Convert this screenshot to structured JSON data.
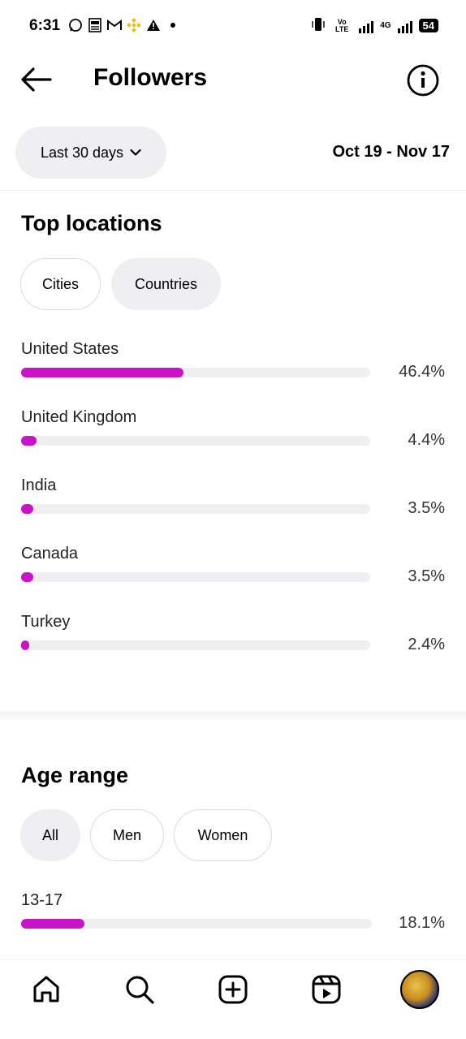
{
  "status_bar": {
    "time": "6:31",
    "network_label_1": "Vo LTE",
    "network_label_2": "4G",
    "battery": "54"
  },
  "header": {
    "title": "Followers",
    "back_icon": "arrow-left-icon",
    "info_icon": "info-circle-icon"
  },
  "filter": {
    "period_label": "Last 30 days",
    "date_range": "Oct 19 - Nov 17"
  },
  "top_locations": {
    "title": "Top locations",
    "tabs": [
      {
        "label": "Cities",
        "selected": false
      },
      {
        "label": "Countries",
        "selected": true
      }
    ],
    "items": [
      {
        "label": "United States",
        "percent": "46.4%",
        "value": 46.4
      },
      {
        "label": "United Kingdom",
        "percent": "4.4%",
        "value": 4.4
      },
      {
        "label": "India",
        "percent": "3.5%",
        "value": 3.5
      },
      {
        "label": "Canada",
        "percent": "3.5%",
        "value": 3.5
      },
      {
        "label": "Turkey",
        "percent": "2.4%",
        "value": 2.4
      }
    ]
  },
  "age_range": {
    "title": "Age range",
    "tabs": [
      {
        "label": "All",
        "selected": true
      },
      {
        "label": "Men",
        "selected": false
      },
      {
        "label": "Women",
        "selected": false
      }
    ],
    "items": [
      {
        "label": "13-17",
        "percent": "18.1%",
        "value": 18.1
      }
    ]
  },
  "colors": {
    "bar_fill": "#c913c8",
    "bar_track": "#efeff2",
    "pill_selected": "#efeff2"
  },
  "bottom_nav": [
    "home-icon",
    "search-icon",
    "create-icon",
    "reels-icon",
    "profile-avatar"
  ]
}
